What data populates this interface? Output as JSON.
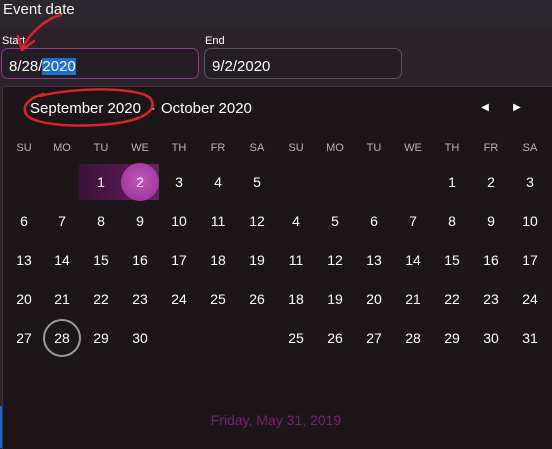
{
  "header": {
    "title": "Event date"
  },
  "start": {
    "label": "Start",
    "value_prefix": "8/28/",
    "value_selected": "2020"
  },
  "end": {
    "label": "End",
    "value": "9/2/2020"
  },
  "calendar": {
    "month_left": "September 2020",
    "separator": "-",
    "month_right": "October 2020",
    "weekdays": [
      "SU",
      "MO",
      "TU",
      "WE",
      "TH",
      "FR",
      "SA"
    ],
    "left_weeks": [
      [
        "",
        "",
        "1",
        "2",
        "3",
        "4",
        "5"
      ],
      [
        "6",
        "7",
        "8",
        "9",
        "10",
        "11",
        "12"
      ],
      [
        "13",
        "14",
        "15",
        "16",
        "17",
        "18",
        "19"
      ],
      [
        "20",
        "21",
        "22",
        "23",
        "24",
        "25",
        "26"
      ],
      [
        "27",
        "28",
        "29",
        "30",
        "",
        "",
        ""
      ]
    ],
    "right_weeks": [
      [
        "",
        "",
        "",
        "",
        "1",
        "2",
        "3"
      ],
      [
        "4",
        "5",
        "6",
        "7",
        "8",
        "9",
        "10"
      ],
      [
        "11",
        "12",
        "13",
        "14",
        "15",
        "16",
        "17"
      ],
      [
        "18",
        "19",
        "20",
        "21",
        "22",
        "23",
        "24"
      ],
      [
        "25",
        "26",
        "27",
        "28",
        "29",
        "30",
        "31"
      ]
    ],
    "selected_day": "2",
    "today_day": "28",
    "prev_icon": "triangle-left-icon",
    "next_icon": "triangle-right-icon"
  },
  "footer": {
    "today_text": "Friday, May 31, 2019"
  },
  "colors": {
    "accent": "#a23b9e",
    "annotation": "#e0202a",
    "selection": "#1b6fd0"
  }
}
